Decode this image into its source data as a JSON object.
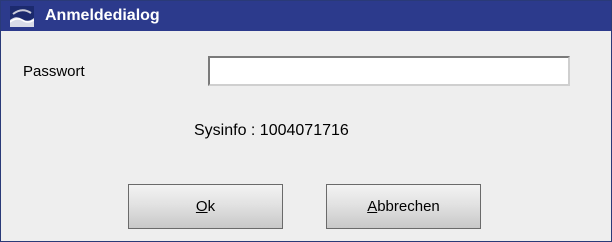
{
  "window": {
    "title": "Anmeldedialog",
    "icon": "app-logo-icon",
    "title_bar_color": "#2c3a8c"
  },
  "form": {
    "password_label": "Passwort",
    "password_value": "",
    "sysinfo": "Sysinfo : 1004071716"
  },
  "buttons": {
    "ok_mnemonic": "O",
    "ok_rest": "k",
    "cancel_mnemonic": "A",
    "cancel_rest": "bbrechen"
  }
}
